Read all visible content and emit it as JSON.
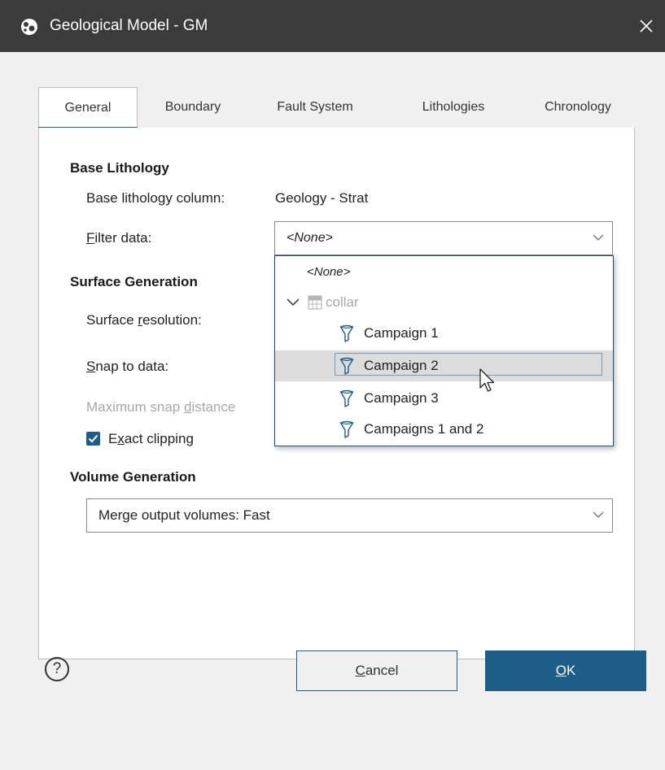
{
  "window": {
    "title": "Geological Model - GM",
    "app_icon": "geomodel-icon",
    "close_icon": "close-icon"
  },
  "tabs": [
    {
      "label": "General",
      "active": true
    },
    {
      "label": "Boundary",
      "active": false
    },
    {
      "label": "Fault System",
      "active": false
    },
    {
      "label": "Lithologies",
      "active": false
    },
    {
      "label": "Chronology",
      "active": false
    }
  ],
  "base_lithology": {
    "heading": "Base Lithology",
    "column_label": "Base lithology column:",
    "column_value": "Geology - Strat",
    "filter_label_mn": "F",
    "filter_label_rest": "ilter data:",
    "filter_value": "<None>"
  },
  "surface_generation": {
    "heading": "Surface Generation",
    "resolution_label_pre": "Surface ",
    "resolution_label_mn": "r",
    "resolution_label_post": "esolution:",
    "snap_label_mn": "S",
    "snap_label_rest": "nap to data:",
    "max_snap_pre": "Maximum snap ",
    "max_snap_mn": "d",
    "max_snap_post": "istance",
    "exact_clipping_pre": "E",
    "exact_clipping_mn": "x",
    "exact_clipping_post": "act clipping",
    "exact_clipping_checked": true
  },
  "volume_generation": {
    "heading": "Volume Generation",
    "merge_value": "Merge output volumes: Fast"
  },
  "dropdown": {
    "none_option": "<None>",
    "group": {
      "label": "collar",
      "expanded": true,
      "icon": "table-icon"
    },
    "filters": [
      {
        "label": "Campaign 1",
        "icon": "filter-icon",
        "highlighted": false
      },
      {
        "label": "Campaign 2",
        "icon": "filter-icon",
        "highlighted": true
      },
      {
        "label": "Campaign 3",
        "icon": "filter-icon",
        "highlighted": false
      },
      {
        "label": "Campaigns 1 and 2",
        "icon": "filter-icon",
        "highlighted": false
      }
    ]
  },
  "footer": {
    "help_label": "?",
    "cancel_mn": "C",
    "cancel_rest": "ancel",
    "ok_mn": "O",
    "ok_rest": "K"
  },
  "colors": {
    "accent": "#1d5d87",
    "titlebar": "#3b3b3b",
    "highlight_row": "#dcdcdc",
    "disabled_text": "#a8a8a8"
  }
}
